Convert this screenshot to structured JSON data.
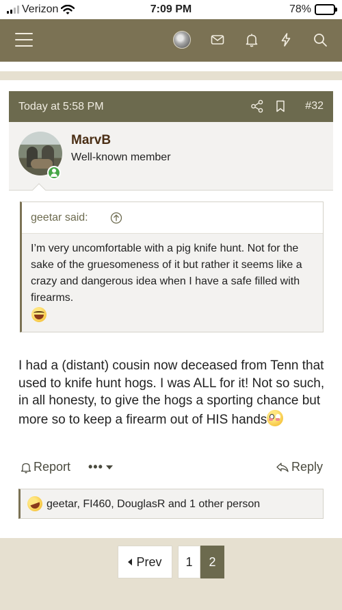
{
  "status_bar": {
    "carrier": "Verizon",
    "time": "7:09 PM",
    "battery": "78%",
    "battery_level": 0.78
  },
  "nav": {
    "icons": [
      "menu-icon",
      "user-avatar",
      "mail-icon",
      "bell-icon",
      "lightning-icon",
      "search-icon"
    ]
  },
  "post": {
    "date": "Today at 5:58 PM",
    "number": "#32",
    "author": {
      "name": "MarvB",
      "title": "Well-known member"
    },
    "quote": {
      "author": "geetar said:",
      "text": "I’m very uncomfortable with a pig knife hunt. Not for the sake of the gruesomeness of it but rather it seems like a crazy and dangerous idea when I have a safe filled with firearms."
    },
    "body": "I had a (distant) cousin now deceased from Tenn that used to knife hunt hogs. I was ALL for it! Not so such, in all honesty, to give the hogs a sporting chance but more so to keep a firearm out of HIS hands",
    "actions": {
      "report": "Report",
      "more": "•••",
      "reply": "Reply"
    },
    "reactions": "geetar, FI460, DouglasR and 1 other person"
  },
  "pagination": {
    "prev": "Prev",
    "pages": [
      "1",
      "2"
    ],
    "current": "2"
  },
  "colors": {
    "nav_bg": "#7b7254",
    "header_bg": "#6c6a4e",
    "page_bg": "#e6e0d0",
    "username": "#4a2e14",
    "online": "#46a647"
  }
}
